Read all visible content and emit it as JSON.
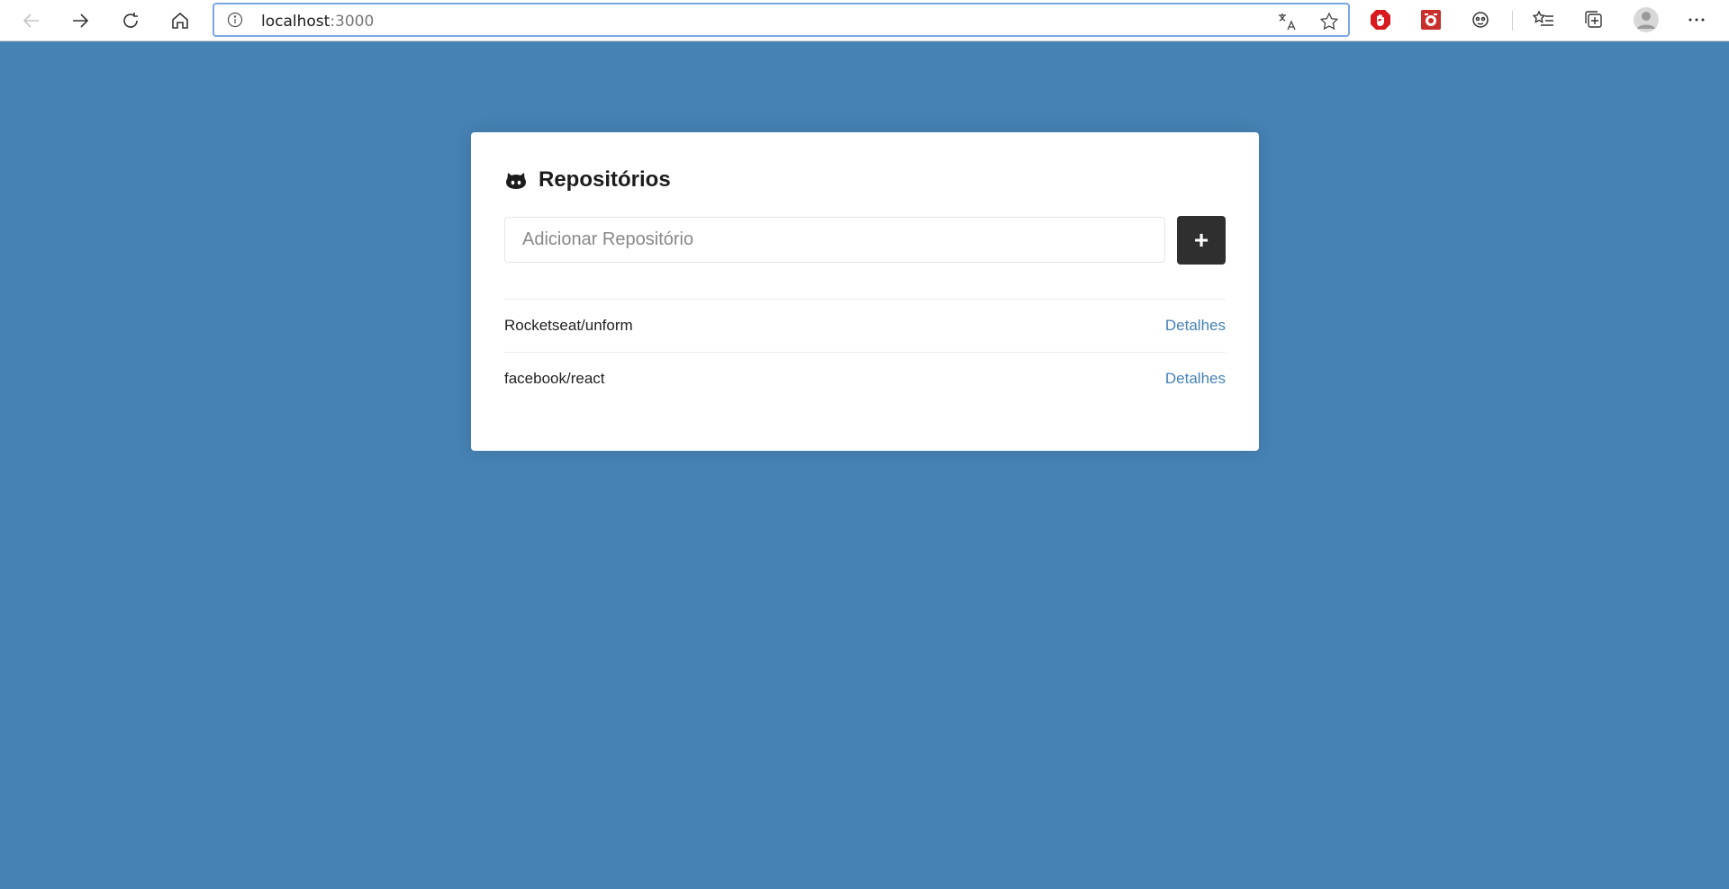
{
  "browser": {
    "url_host": "localhost",
    "url_port": ":3000"
  },
  "page": {
    "title": "Repositórios",
    "input_placeholder": "Adicionar Repositório",
    "add_label": "+",
    "repos": [
      {
        "name": "Rocketseat/unform",
        "link": "Detalhes"
      },
      {
        "name": "facebook/react",
        "link": "Detalhes"
      }
    ]
  },
  "colors": {
    "background": "#4682b4",
    "button": "#2f2f2f",
    "link": "#4682b4"
  }
}
